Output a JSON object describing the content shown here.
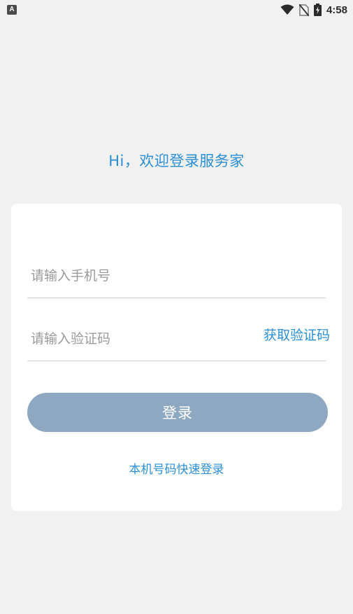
{
  "status_bar": {
    "app_icon_letter": "A",
    "time": "4:58",
    "icons": [
      "wifi-icon",
      "no-sim-icon",
      "battery-charging-icon"
    ]
  },
  "greeting": "Hi，欢迎登录服务家",
  "form": {
    "phone_placeholder": "请输入手机号",
    "code_placeholder": "请输入验证码",
    "get_code_label": "获取验证码",
    "login_label": "登录",
    "quick_login_label": "本机号码快速登录"
  },
  "colors": {
    "background": "#f2f1f2",
    "accent": "#2b8fd6",
    "button_disabled": "#8fa8c1",
    "card": "#ffffff"
  }
}
